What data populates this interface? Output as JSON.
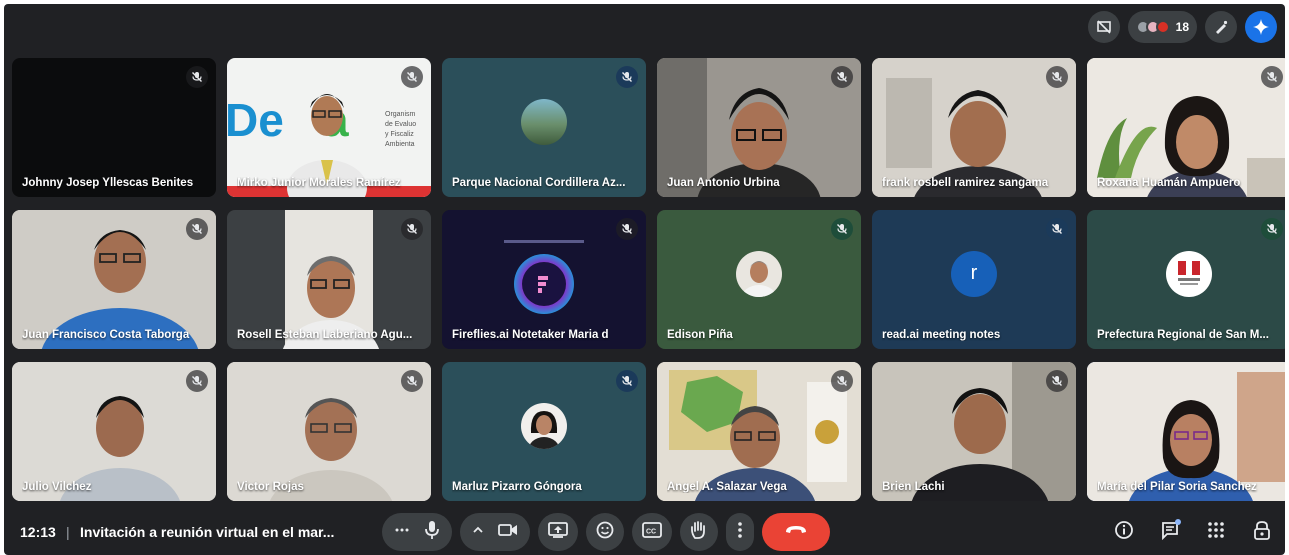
{
  "top_bar": {
    "participant_count": "18",
    "icons": [
      "presentation-off-icon",
      "people-icon",
      "pen-icon",
      "gemini-icon"
    ]
  },
  "participants": [
    {
      "name": "Johnny Josep Yllescas Benites",
      "muted": true
    },
    {
      "name": "Mirko Junior Morales Ramírez",
      "muted": true,
      "banner_text": "Organismo de Evaluación y Fiscalización Ambiental"
    },
    {
      "name": "Parque Nacional Cordillera Az...",
      "muted": true
    },
    {
      "name": "Juan Antonio Urbina",
      "muted": true
    },
    {
      "name": "frank rosbell ramirez sangama",
      "muted": true
    },
    {
      "name": "Roxana Huamán Ampuero",
      "muted": true
    },
    {
      "name": "Juan Francisco Costa Taborga",
      "muted": true
    },
    {
      "name": "Rosell Esteban Laberiano Agu...",
      "muted": true
    },
    {
      "name": "Fireflies.ai Notetaker Maria d",
      "muted": true
    },
    {
      "name": "Edison Piña",
      "muted": true
    },
    {
      "name": "read.ai meeting notes",
      "muted": true,
      "avatar_letter": "r"
    },
    {
      "name": "Prefectura Regional de San M...",
      "muted": true
    },
    {
      "name": "Julio Vilchez",
      "muted": true
    },
    {
      "name": "Victor Rojas",
      "muted": true
    },
    {
      "name": "Marluz Pizarro Góngora",
      "muted": true
    },
    {
      "name": "Angel A. Salazar Vega",
      "muted": true
    },
    {
      "name": "Brien Lachi",
      "muted": true
    },
    {
      "name": "María del Pilar Soria Sanchez",
      "muted": false,
      "active_speaker": true
    }
  ],
  "bottom_bar": {
    "time": "12:13",
    "separator": "|",
    "meeting_title": "Invitación a reunión virtual en el mar...",
    "controls": [
      "more-options-icon",
      "microphone-icon",
      "chevron-up-icon",
      "camera-icon",
      "present-screen-icon",
      "emoji-icon",
      "captions-icon",
      "raise-hand-icon",
      "more-vert-icon",
      "end-call-icon"
    ],
    "right_controls": [
      "info-icon",
      "chat-icon",
      "activities-icon",
      "host-controls-icon"
    ]
  },
  "colors": {
    "frame_bg": "#202124",
    "tile_bg": "#3c4043",
    "end_call": "#ea4335",
    "active_outline": "#a8c7fa",
    "accent_blue": "#1a73e8"
  }
}
